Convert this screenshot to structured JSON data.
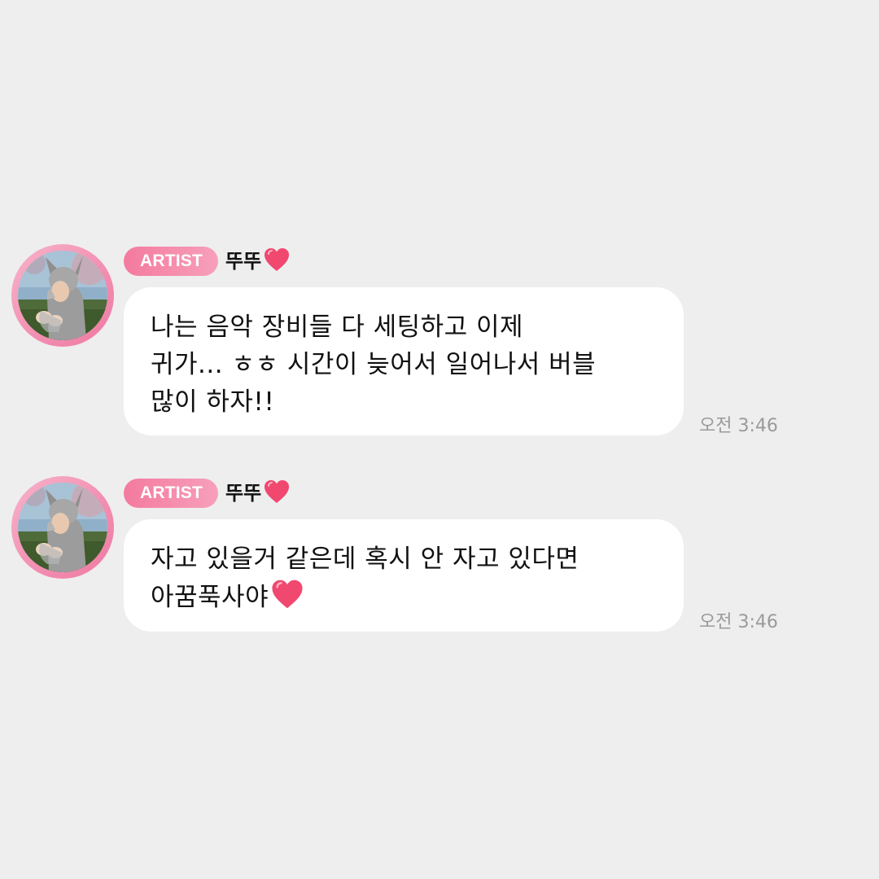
{
  "colors": {
    "background": "#eeeeee",
    "bubble": "#ffffff",
    "badge_start": "#f47a9f",
    "badge_end": "#f7a0bb",
    "heart": "#f0486f",
    "time_text": "#9a9a9a"
  },
  "messages": [
    {
      "badge": "ARTIST",
      "sender": "뚜뚜",
      "sender_icon": "heart-icon",
      "text": "나는 음악 장비들 다 세팅하고 이제\n귀가... ㅎㅎ 시간이 늦어서 일어나서 버블\n많이 하자!!",
      "time": "오전 3:46"
    },
    {
      "badge": "ARTIST",
      "sender": "뚜뚜",
      "sender_icon": "heart-icon",
      "text": "자고 있을거 같은데 혹시 안 자고 있다면\n아꿈푹사야",
      "text_trailing_icon": "heart-icon",
      "time": "오전 3:46"
    }
  ]
}
